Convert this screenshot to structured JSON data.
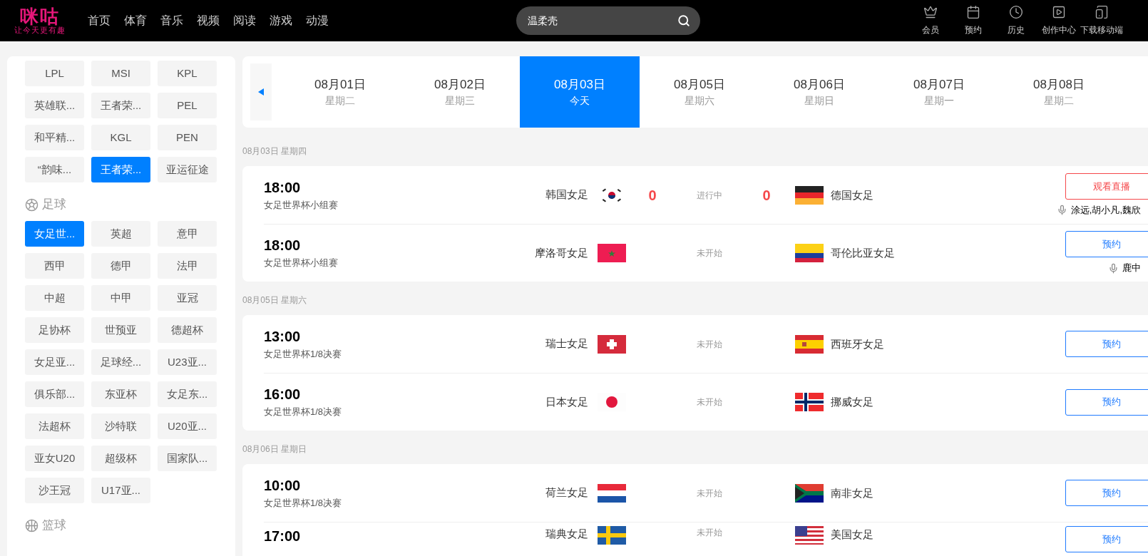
{
  "header": {
    "logo": {
      "name": "咪咕",
      "slogan": "让今天更有趣"
    },
    "nav": [
      "首页",
      "体育",
      "音乐",
      "视频",
      "阅读",
      "游戏",
      "动漫"
    ],
    "search": {
      "value": "温柔壳"
    },
    "actions": [
      "会员",
      "预约",
      "历史",
      "创作中心",
      "下载移动端"
    ]
  },
  "sidebar": {
    "groups": [
      {
        "items": [
          {
            "label": "LPL",
            "selected": false
          },
          {
            "label": "MSI",
            "selected": false
          },
          {
            "label": "KPL",
            "selected": false
          },
          {
            "label": "英雄联...",
            "selected": false
          },
          {
            "label": "王者荣...",
            "selected": false
          },
          {
            "label": "PEL",
            "selected": false
          },
          {
            "label": "和平精...",
            "selected": false
          },
          {
            "label": "KGL",
            "selected": false
          },
          {
            "label": "PEN",
            "selected": false
          },
          {
            "label": "“韵味...",
            "selected": false
          },
          {
            "label": "王者荣...",
            "selected": true
          },
          {
            "label": "亚运征途",
            "selected": false
          }
        ]
      },
      {
        "kind": "football",
        "title": "足球",
        "items": [
          {
            "label": "女足世...",
            "selected": true
          },
          {
            "label": "英超",
            "selected": false
          },
          {
            "label": "意甲",
            "selected": false
          },
          {
            "label": "西甲",
            "selected": false
          },
          {
            "label": "德甲",
            "selected": false
          },
          {
            "label": "法甲",
            "selected": false
          },
          {
            "label": "中超",
            "selected": false
          },
          {
            "label": "中甲",
            "selected": false
          },
          {
            "label": "亚冠",
            "selected": false
          },
          {
            "label": "足协杯",
            "selected": false
          },
          {
            "label": "世预亚",
            "selected": false
          },
          {
            "label": "德超杯",
            "selected": false
          },
          {
            "label": "女足亚...",
            "selected": false
          },
          {
            "label": "足球经...",
            "selected": false
          },
          {
            "label": "U23亚...",
            "selected": false
          },
          {
            "label": "俱乐部...",
            "selected": false
          },
          {
            "label": "东亚杯",
            "selected": false
          },
          {
            "label": "女足东...",
            "selected": false
          },
          {
            "label": "法超杯",
            "selected": false
          },
          {
            "label": "沙特联",
            "selected": false
          },
          {
            "label": "U20亚...",
            "selected": false
          },
          {
            "label": "亚女U20",
            "selected": false
          },
          {
            "label": "超级杯",
            "selected": false
          },
          {
            "label": "国家队...",
            "selected": false
          },
          {
            "label": "沙王冠",
            "selected": false
          },
          {
            "label": "U17亚...",
            "selected": false
          }
        ]
      },
      {
        "kind": "basketball",
        "title": "篮球"
      }
    ]
  },
  "date_bar": {
    "dates": [
      {
        "date": "08月01日",
        "weekday": "星期二",
        "selected": false
      },
      {
        "date": "08月02日",
        "weekday": "星期三",
        "selected": false
      },
      {
        "date": "08月03日",
        "weekday": "今天",
        "selected": true
      },
      {
        "date": "08月05日",
        "weekday": "星期六",
        "selected": false
      },
      {
        "date": "08月06日",
        "weekday": "星期日",
        "selected": false
      },
      {
        "date": "08月07日",
        "weekday": "星期一",
        "selected": false
      },
      {
        "date": "08月08日",
        "weekday": "星期二",
        "selected": false
      }
    ]
  },
  "sections": [
    {
      "heading": "08月03日 星期四",
      "matches": [
        {
          "time": "18:00",
          "competition": "女足世界杯小组赛",
          "home": "韩国女足",
          "home_score": "0",
          "status": "进行中",
          "away_score": "0",
          "away": "德国女足",
          "button": {
            "kind": "live",
            "label": "观看直播"
          },
          "commentators": "涂远,胡小凡,魏欣"
        },
        {
          "time": "18:00",
          "competition": "女足世界杯小组赛",
          "home": "摩洛哥女足",
          "status": "未开始",
          "away": "哥伦比亚女足",
          "button": {
            "kind": "reserve",
            "label": "预约"
          },
          "commentators": "鹿中"
        }
      ]
    },
    {
      "heading": "08月05日 星期六",
      "matches": [
        {
          "time": "13:00",
          "competition": "女足世界杯1/8决赛",
          "home": "瑞士女足",
          "status": "未开始",
          "away": "西班牙女足",
          "button": {
            "kind": "reserve",
            "label": "预约"
          }
        },
        {
          "time": "16:00",
          "competition": "女足世界杯1/8决赛",
          "home": "日本女足",
          "status": "未开始",
          "away": "挪威女足",
          "button": {
            "kind": "reserve",
            "label": "预约"
          }
        }
      ]
    },
    {
      "heading": "08月06日 星期日",
      "matches": [
        {
          "time": "10:00",
          "competition": "女足世界杯1/8决赛",
          "home": "荷兰女足",
          "status": "未开始",
          "away": "南非女足",
          "button": {
            "kind": "reserve",
            "label": "预约"
          }
        },
        {
          "time": "17:00",
          "home": "瑞典女足",
          "status": "未开始",
          "away": "美国女足",
          "button": {
            "kind": "reserve",
            "label": "预约"
          }
        }
      ]
    }
  ]
}
